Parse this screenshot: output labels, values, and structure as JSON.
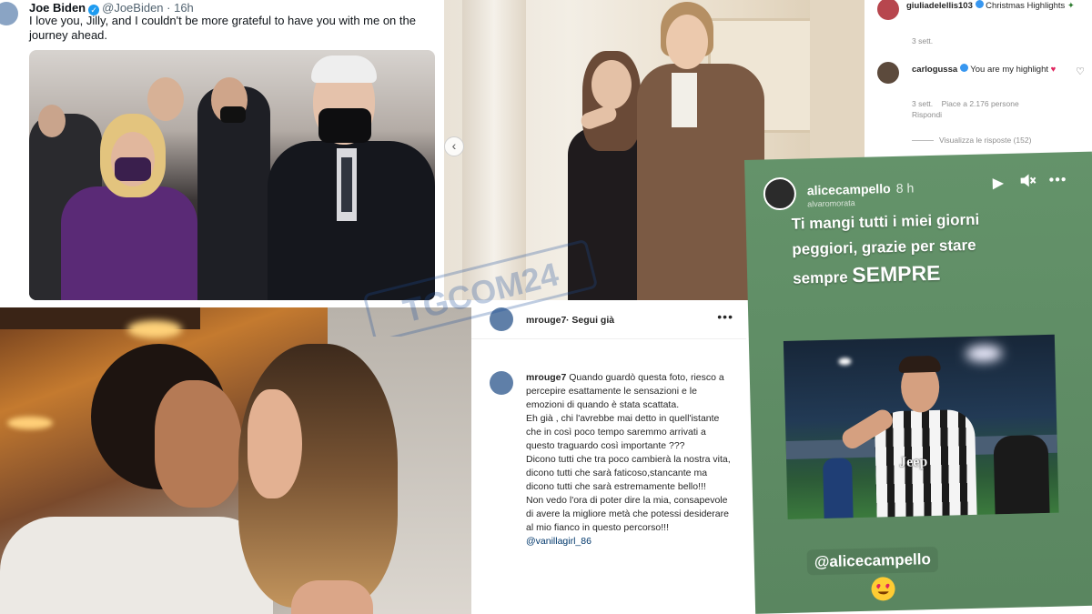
{
  "tweet": {
    "name": "Joe Biden",
    "handle": "@JoeBiden",
    "time": "· 16h",
    "text": "I love you, Jilly, and I couldn't be more grateful to have you with me on the journey ahead."
  },
  "ig_comments": {
    "c1_user": "giuliadelellis103",
    "c1_text": "Christmas Highlights",
    "c1_time": "3 sett.",
    "c2_user": "carlogussa",
    "c2_text": "You are my highlight",
    "c2_time": "3 sett.",
    "c2_likes": "Piace a 2.176 persone",
    "c2_reply": "Rispondi",
    "view_replies": "Visualizza le risposte (152)"
  },
  "post": {
    "user": "mrouge7",
    "follow": "· Segui già",
    "caption_p1": "Quando guardò questa foto, riesco a percepire esattamente le sensazioni e le emozioni di quando è stata scattata.",
    "caption_p2": "Eh già , chi l'avrebbe mai detto in quell'istante che in così poco tempo saremmo arrivati a questo traguardo così importante ???",
    "caption_p3": "Dicono tutti che tra poco cambierà la nostra vita, dicono tutti che sarà faticoso,stancante ma dicono tutti che sarà estremamente bello!!!",
    "caption_p4": "Non vedo l'ora di poter dire la mia, consapevole di avere la migliore metà che potessi desiderare al mio fianco in questo percorso!!!",
    "caption_mention": "@vanillagirl_86"
  },
  "story": {
    "user": "alicecampello",
    "time": "8 h",
    "sub": "alvaromorata",
    "line1": "Ti mangi tutti i miei giorni",
    "line2": "peggiori, grazie per stare",
    "line3a": "sempre",
    "line3b": "SEMPRE",
    "mention": "@alicecampello",
    "jersey": "Jeep"
  },
  "watermark": "TGCOM24",
  "colors": {
    "twitter_blue": "#1d9bf0",
    "story_green": "#5d8a63",
    "mention_blue": "#00376b"
  }
}
